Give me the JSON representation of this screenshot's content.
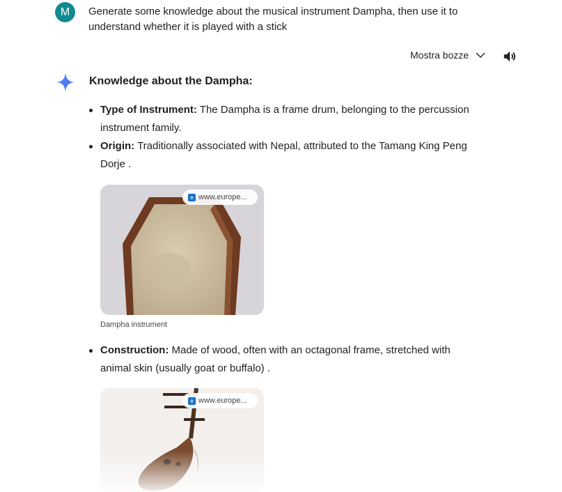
{
  "user": {
    "avatar_letter": "M",
    "prompt": "Generate some knowledge about the musical instrument Dampha, then use it to understand whether it is played with a stick"
  },
  "toolbar": {
    "drafts_label": "Mostra bozze"
  },
  "response": {
    "heading": "Knowledge about the Dampha:",
    "facts": [
      {
        "label": "Type of Instrument:",
        "text": " The Dampha is a frame drum, belonging to the percussion instrument family."
      },
      {
        "label": "Origin:",
        "text": " Traditionally associated with Nepal, attributed to the Tamang King Peng Dorje ."
      },
      {
        "label": "Construction:",
        "text": " Made of wood, often with an octagonal frame, stretched with animal skin (usually goat or buffalo) ."
      }
    ],
    "images": [
      {
        "source": "www.europe...",
        "caption": "Dampha instrument"
      },
      {
        "source": "www.europe..."
      }
    ]
  },
  "colors": {
    "avatar": "#138a8f",
    "text": "#1f1f1f",
    "spark_blue": "#4a7bf0"
  }
}
